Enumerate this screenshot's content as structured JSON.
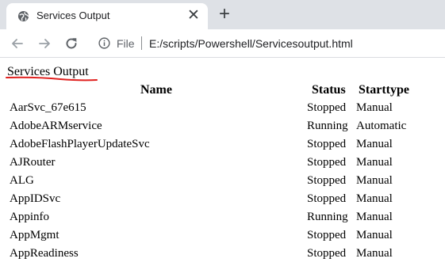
{
  "tab": {
    "title": "Services Output",
    "favicon": "globe-icon",
    "close": "✕",
    "newtab": "+"
  },
  "toolbar": {
    "scheme": "File",
    "url": "E:/scripts/Powershell/Servicesoutput.html"
  },
  "page": {
    "title": "Services Output",
    "underline_color": "#e0201e",
    "columns": {
      "name": "Name",
      "status": "Status",
      "starttype": "Starttype"
    },
    "rows": [
      {
        "name": "AarSvc_67e615",
        "status": "Stopped",
        "starttype": "Manual"
      },
      {
        "name": "AdobeARMservice",
        "status": "Running",
        "starttype": "Automatic"
      },
      {
        "name": "AdobeFlashPlayerUpdateSvc",
        "status": "Stopped",
        "starttype": "Manual"
      },
      {
        "name": "AJRouter",
        "status": "Stopped",
        "starttype": "Manual"
      },
      {
        "name": "ALG",
        "status": "Stopped",
        "starttype": "Manual"
      },
      {
        "name": "AppIDSvc",
        "status": "Stopped",
        "starttype": "Manual"
      },
      {
        "name": "Appinfo",
        "status": "Running",
        "starttype": "Manual"
      },
      {
        "name": "AppMgmt",
        "status": "Stopped",
        "starttype": "Manual"
      },
      {
        "name": "AppReadiness",
        "status": "Stopped",
        "starttype": "Manual"
      }
    ]
  }
}
